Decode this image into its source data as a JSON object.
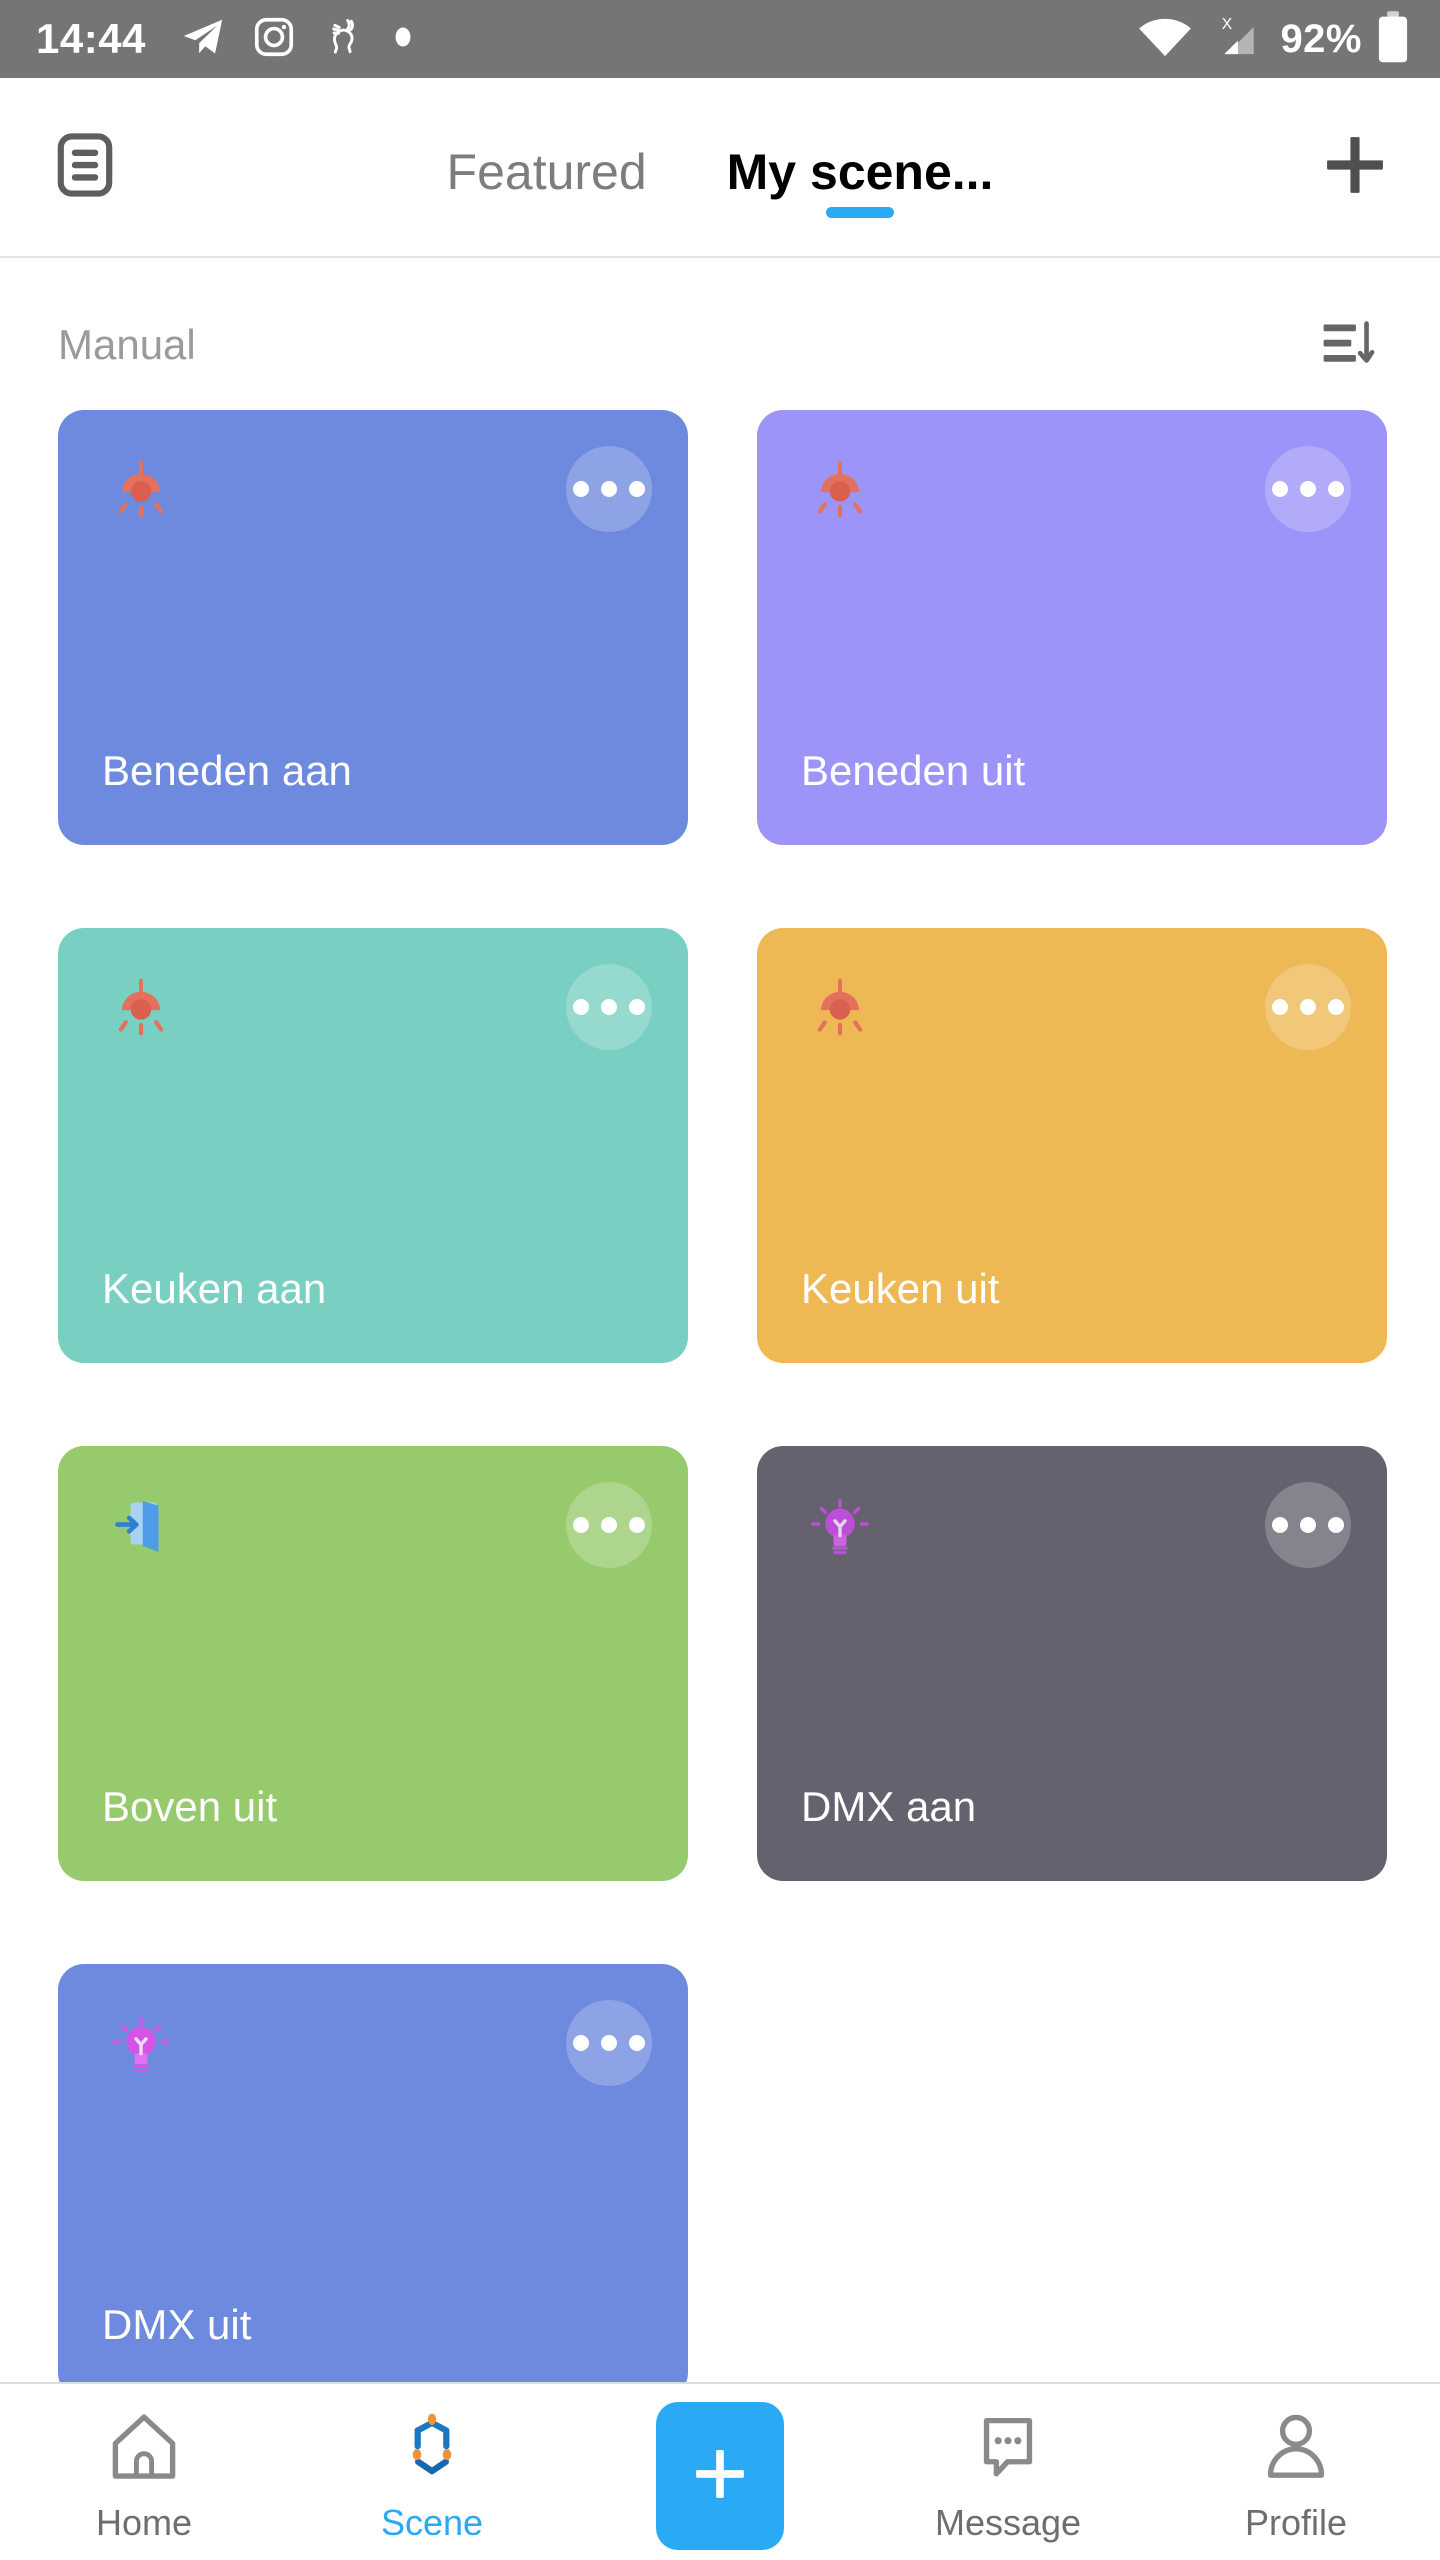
{
  "status_bar": {
    "time": "14:44",
    "battery_percent": "92%",
    "left_icons": [
      "telegram-icon",
      "instagram-icon",
      "rabbit-app-icon",
      "dot-indicator-icon"
    ],
    "right_icons": [
      "wifi-icon",
      "signal-no-service-icon",
      "battery-icon"
    ],
    "background_color": "#757575"
  },
  "header": {
    "menu_icon": "document-list-icon",
    "add_icon": "plus-icon",
    "tabs": [
      {
        "label": "Featured",
        "active": false
      },
      {
        "label": "My scene...",
        "active": true
      }
    ],
    "active_indicator_color": "#2aa9f4"
  },
  "section": {
    "title": "Manual",
    "sort_icon": "sort-descending-icon"
  },
  "scenes": [
    {
      "name": "Beneden aan",
      "color": "#6e8ade",
      "icon": "pendant-lamp-icon",
      "icon_color": "#e4705e"
    },
    {
      "name": "Beneden uit",
      "color": "#9c94f9",
      "icon": "pendant-lamp-icon",
      "icon_color": "#e4705e"
    },
    {
      "name": "Keuken aan",
      "color": "#78cfc2",
      "icon": "pendant-lamp-icon",
      "icon_color": "#e4705e"
    },
    {
      "name": "Keuken uit",
      "color": "#eeb855",
      "icon": "pendant-lamp-icon",
      "icon_color": "#e4705e"
    },
    {
      "name": "Boven uit",
      "color": "#97ca6d",
      "icon": "door-exit-icon",
      "icon_color": "#4e9ce8"
    },
    {
      "name": "DMX aan",
      "color": "#66616f",
      "icon": "light-bulb-icon",
      "icon_color": "#bb4fd8"
    },
    {
      "name": "DMX uit",
      "color": "#6e8ade",
      "icon": "light-bulb-icon",
      "icon_color": "#d255e8"
    }
  ],
  "bottom_nav": {
    "items": [
      {
        "label": "Home",
        "icon": "home-icon",
        "active": false
      },
      {
        "label": "Scene",
        "icon": "scene-hexagon-icon",
        "active": true
      },
      {
        "label": "",
        "icon": "plus-icon",
        "active": false,
        "is_fab": true
      },
      {
        "label": "Message",
        "icon": "message-bubble-icon",
        "active": false
      },
      {
        "label": "Profile",
        "icon": "person-icon",
        "active": false
      }
    ],
    "accent_color": "#2aa9f4"
  }
}
